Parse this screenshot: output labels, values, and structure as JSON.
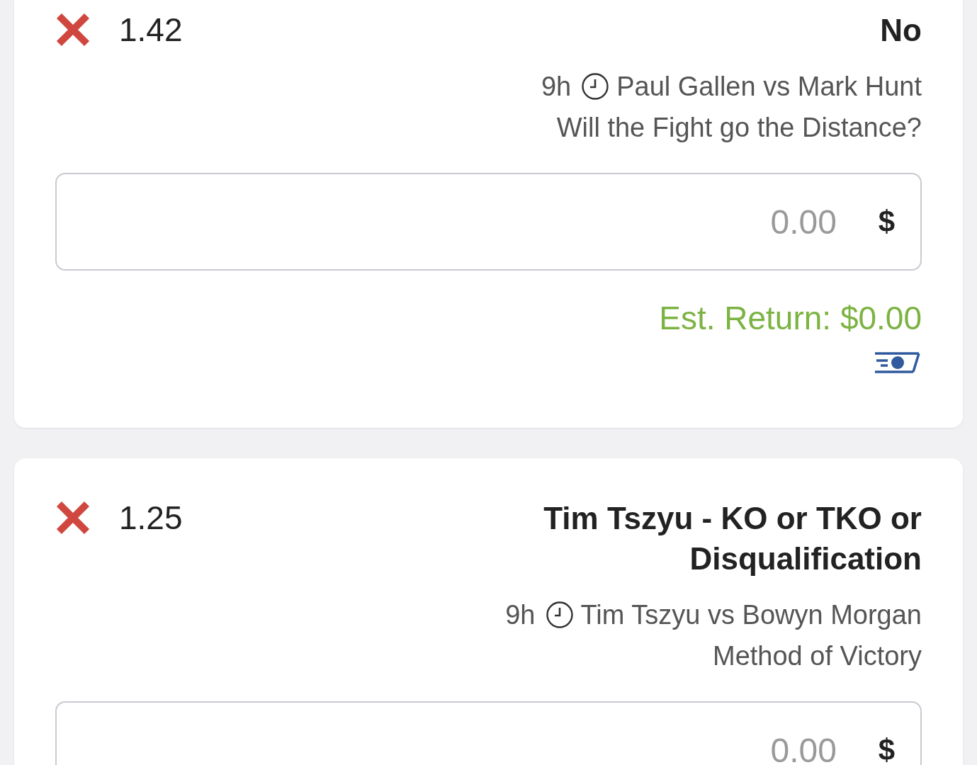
{
  "bets": [
    {
      "selection": "No",
      "odds": "1.42",
      "event": "Paul Gallen vs Mark Hunt",
      "time": "9h",
      "market": "Will the Fight go the Distance?",
      "currency": "$",
      "placeholder": "0.00",
      "est_return": "Est. Return: $0.00"
    },
    {
      "selection": "Tim Tszyu - KO or TKO or Disqualification",
      "odds": "1.25",
      "event": "Tim Tszyu vs Bowyn Morgan",
      "time": "9h",
      "market": "Method of Victory",
      "currency": "$",
      "placeholder": "0.00"
    }
  ]
}
